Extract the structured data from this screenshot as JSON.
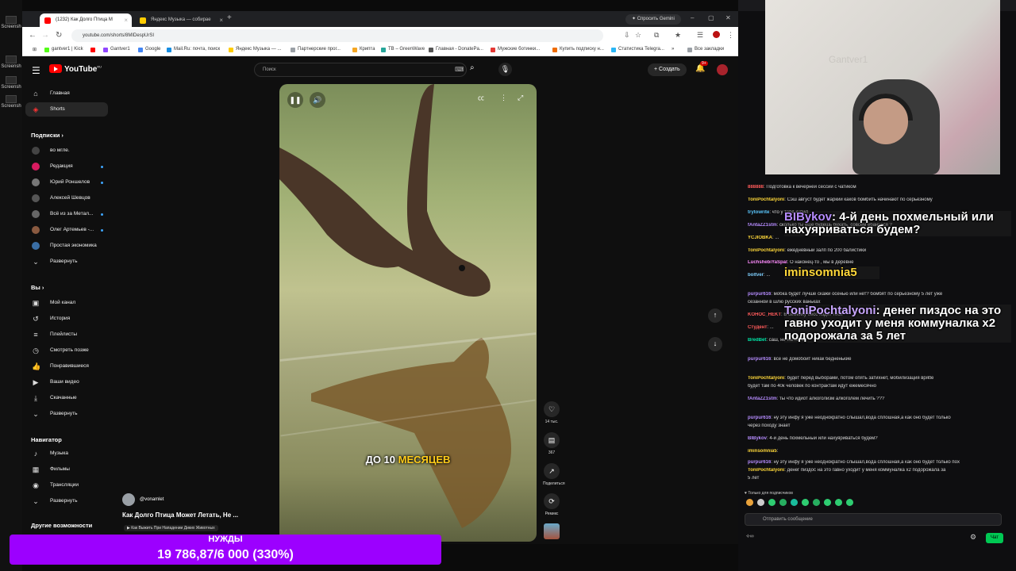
{
  "desktop": {
    "items": [
      "Screensh",
      "Screensh",
      "Screensh",
      "Screensh"
    ]
  },
  "browser": {
    "tabs": [
      {
        "label": "(1232) Как Долго Птица М",
        "active": true
      },
      {
        "label": "Яндекс Музыка — собирае",
        "active": false
      }
    ],
    "new_tab": "+",
    "gemini": "✦ Спросить Gemini",
    "url": "youtube.com/shorts/8MIDespUrSI",
    "bookmarks": [
      "gantver1 | Kick",
      "",
      "Gantver1",
      "Google",
      "Mail.Ru: почта, поиск",
      "Яндекс Музыка — ...",
      "Партнерские прог...",
      "Криптa",
      "TB – GreenWave",
      "Главная - DonatePa...",
      "Мужские ботинки...",
      "Купить подписку н...",
      "Статистика Telegra...",
      "Все закладки"
    ],
    "bookmark_more": "»"
  },
  "youtube": {
    "logo_text": "YouTube",
    "logo_sup": "RU",
    "search_placeholder": "Поиск",
    "create": "+ Создать",
    "bell_badge": "9+",
    "sidebar": {
      "main": [
        {
          "label": "Главная",
          "icon": "home-icon"
        },
        {
          "label": "Shorts",
          "icon": "shorts-icon"
        }
      ],
      "subscriptions_title": "Подписки",
      "subscriptions": [
        {
          "label": "во мгле.",
          "dot": false,
          "color": "#444"
        },
        {
          "label": "Редакция",
          "dot": true,
          "color": "#d81b60"
        },
        {
          "label": "Юрий Роншелов",
          "dot": true,
          "color": "#777"
        },
        {
          "label": "Алексей Шевцов",
          "dot": false,
          "color": "#555"
        },
        {
          "label": "Всё из за Метал...",
          "dot": true,
          "color": "#666"
        },
        {
          "label": "Олег Артемьев -...",
          "dot": true,
          "color": "#8a5a40"
        },
        {
          "label": "Простая экономика",
          "dot": false,
          "color": "#3a6ea5"
        }
      ],
      "expand1": "Развернуть",
      "you_title": "Вы",
      "you": [
        {
          "label": "Мой канал",
          "icon": "channel-icon"
        },
        {
          "label": "История",
          "icon": "history-icon"
        },
        {
          "label": "Плейлисты",
          "icon": "playlist-icon"
        },
        {
          "label": "Смотреть позже",
          "icon": "clock-icon"
        },
        {
          "label": "Понравившиеся",
          "icon": "like-icon"
        },
        {
          "label": "Ваши видео",
          "icon": "video-icon"
        },
        {
          "label": "Скачанные",
          "icon": "download-icon"
        }
      ],
      "expand2": "Развернуть",
      "nav_title": "Навигатор",
      "nav": [
        {
          "label": "Музыка",
          "icon": "music-icon"
        },
        {
          "label": "Фильмы",
          "icon": "film-icon"
        },
        {
          "label": "Трансляции",
          "icon": "live-icon"
        }
      ],
      "expand3": "Развернуть",
      "other_title": "Другие возможности"
    },
    "video": {
      "caption_pre": "ДО 10 ",
      "caption_hl": "МЕСЯЦЕВ",
      "channel": "@vonamlet",
      "title": "Как Долго Птица Может Летать, Не ...",
      "subtitle": "▶ Как Выжить При Нападении Диких Животных"
    },
    "actions": [
      {
        "label": "14 тыс.",
        "icon": "heart-icon",
        "glyph": "♡"
      },
      {
        "label": "367",
        "icon": "comment-icon",
        "glyph": "▤"
      },
      {
        "label": "Поделиться",
        "icon": "share-icon",
        "glyph": "↗"
      },
      {
        "label": "Ремикс",
        "icon": "remix-icon",
        "glyph": "⟳"
      }
    ]
  },
  "donation": {
    "label": "НУЖДЫ",
    "value": "19 786,87/6 000 (330%)"
  },
  "stream": {
    "wall_text": "Gantver1"
  },
  "chat": {
    "lines": [
      {
        "user": "888888",
        "color": "#ff5b5b",
        "text": ": Подготовка к вечерней сессии с чатиком"
      },
      {
        "user": "ToniPochtalyoni",
        "color": "#ffd83a",
        "text": ": Сэш август будет жаркий каков бомбить начинают по серьезному"
      },
      {
        "user": "trytowrite",
        "color": "#5bc8ff",
        "text": ": что у тебя купил"
      },
      {
        "user": "fAntaZZ1stm",
        "color": "#b68cff",
        "text": ": сколько ты еще будешь бухать, совсем ебанулся ?"
      },
      {
        "user": "YCJIOBKA",
        "color": "#ffd83a",
        "text": ": ..."
      },
      {
        "user": "ToniPochtalyoni",
        "color": "#ffd83a",
        "text": ": ежедневный залп по 200 балистики"
      },
      {
        "user": "LuchshebiYaSpal",
        "color": "#ff8cff",
        "text": ": О наконец-то , мы в деревне"
      },
      {
        "user": "boltver",
        "color": "#7fd0ff",
        "text": ": ..."
      },
      {
        "user": "purpur616",
        "color": "#b68cff",
        "text": ": мобка будет лучше скажи осенью или нет? бомбят по серьезному 5 лет уже"
      },
      {
        "user": "",
        "color": "#ccc",
        "text": "сезанной в шлю русских ваньках"
      },
      {
        "user": "KOHOC_HEKT",
        "color": "#ff5b5b",
        "text": ": В семейку бесс ходят теси"
      },
      {
        "user": "Студент",
        "color": "#ff5b5b",
        "text": ": ..."
      },
      {
        "user": "BredBet",
        "color": "#00e6a8",
        "text": ": саш, не нагнетай"
      },
      {
        "user": "purpur616",
        "color": "#b68cff",
        "text": ": все не домобойт никак бедненькие"
      },
      {
        "user": "ToniPochtalyoni",
        "color": "#ffd83a",
        "text": ": будет перед выборами, потом опять затихнет, мобилизация вряtle"
      },
      {
        "user": "",
        "color": "#ccc",
        "text": "будет там по 40к человек по контрактам идут ежемесячно"
      },
      {
        "user": "fAntaZZ1stm",
        "color": "#b68cff",
        "text": ": ты что идиот алкоголизм алкоголем лечить ???"
      },
      {
        "user": "purpur616",
        "color": "#b68cff",
        "text": ": ну эту инфу я уже неоднократно слышал,вода сплошная,а как оно будет только"
      },
      {
        "user": "",
        "color": "#ccc",
        "text": "через походу знает"
      },
      {
        "user": "BIBykov",
        "color": "#b68cff",
        "text": ": 4-й день похмельный или нахуяриваться будем?"
      },
      {
        "user": "iminsomnia5",
        "color": "#ffd83a",
        "text": ":"
      },
      {
        "user": "purpur616",
        "color": "#b68cff",
        "text": ": ну эту инфу я уже неоднократно слышал,вода сплошная,а как оно будет только пох"
      },
      {
        "user": "ToniPochtalyoni",
        "color": "#ffd83a",
        "text": ": денег пиздос на это гавно уходит у меня коммуналка x2 подорожала за"
      },
      {
        "user": "",
        "color": "#ccc",
        "text": "5 лет"
      }
    ],
    "overlay": [
      {
        "user": "BIBykov",
        "text": ": 4-й день похмельный или нахуяриваться будем?"
      },
      {
        "user": "iminsomnia5",
        "text": ""
      },
      {
        "user": "ToniPochtalyoni",
        "text": ": денег пиздос на это гавно уходит у меня коммуналка x2 подорожала за 5 лет"
      }
    ],
    "sub_only": "♥ Только для подписчиков",
    "input_placeholder": "Отправить сообщение",
    "chat_button": "Чат"
  }
}
